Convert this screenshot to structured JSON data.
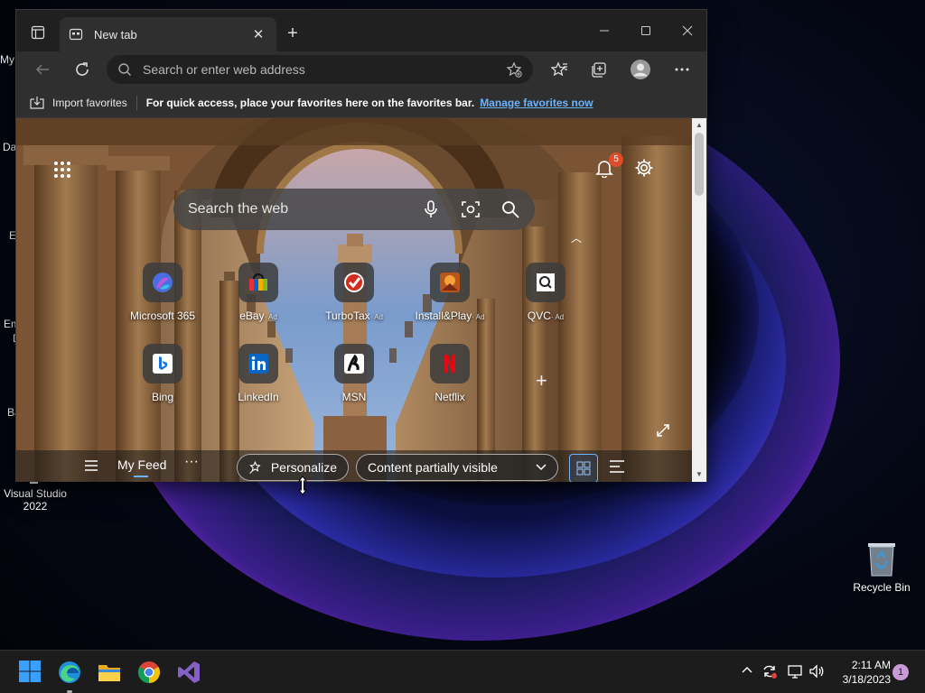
{
  "desktop": {
    "left_icon_fragments": [
      "My",
      "Da",
      "E",
      "Em",
      "D",
      "Ba"
    ],
    "icons": {
      "visual_studio": "Visual Studio 2022",
      "recycle_bin": "Recycle Bin"
    }
  },
  "browser": {
    "tab": {
      "title": "New tab"
    },
    "address_bar": {
      "placeholder": "Search or enter web address"
    },
    "favorites_bar": {
      "import_label": "Import favorites",
      "hint": "For quick access, place your favorites here on the favorites bar.",
      "manage_link": "Manage favorites now"
    },
    "new_tab_page": {
      "notification_count": "5",
      "search_placeholder": "Search the web",
      "quick_links": [
        {
          "label": "Microsoft 365",
          "ad": ""
        },
        {
          "label": "eBay",
          "ad": "· Ad"
        },
        {
          "label": "TurboTax",
          "ad": "· Ad"
        },
        {
          "label": "Install&Play",
          "ad": "· Ad"
        },
        {
          "label": "QVC",
          "ad": "· Ad"
        },
        {
          "label": "Bing",
          "ad": ""
        },
        {
          "label": "LinkedIn",
          "ad": ""
        },
        {
          "label": "MSN",
          "ad": ""
        },
        {
          "label": "Netflix",
          "ad": ""
        }
      ],
      "feed_bar": {
        "my_feed": "My Feed",
        "more": "···",
        "personalize": "Personalize",
        "visibility": "Content partially visible"
      }
    }
  },
  "taskbar": {
    "clock": {
      "time": "2:11 AM",
      "date": "3/18/2023"
    },
    "notification_badge": "1"
  },
  "colors": {
    "accent": "#6cb4ff",
    "bell_badge": "#e04b2a",
    "window_bg": "#202020",
    "toolbar_bg": "#2f2f2f"
  }
}
